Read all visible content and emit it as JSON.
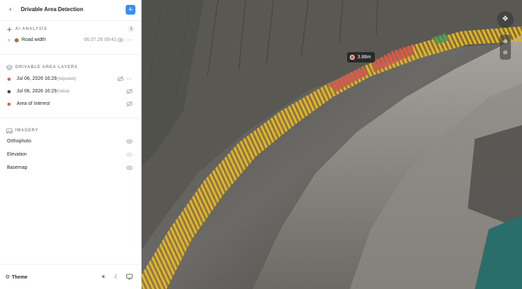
{
  "header": {
    "back_icon": "chevron-left-icon",
    "title": "Drivable Area Detection",
    "add_icon": "plus-icon"
  },
  "ai_analysis": {
    "title": "AI ANALYSIS",
    "count": "1",
    "item": {
      "label": "Road width",
      "timestamp": "06.07.26 09:41"
    }
  },
  "layers": {
    "title": "DRIVABLE AREA LAYERS",
    "items": [
      {
        "label": "Jul 06, 2026 16:29",
        "tag": "(Adjusted)",
        "dot_color": "#e5534b"
      },
      {
        "label": "Jul 06, 2026 16:29",
        "tag": "(Initial)",
        "dot_color": "#3d3d3d"
      },
      {
        "label": "Area of Interest",
        "tag": "",
        "dot_color": "#e5534b"
      }
    ]
  },
  "imagery": {
    "title": "IMAGERY",
    "items": [
      {
        "label": "Orthophoto"
      },
      {
        "label": "Elevation"
      },
      {
        "label": "Basemap"
      }
    ]
  },
  "footer": {
    "theme_label": "Theme"
  },
  "map": {
    "measurement": "3.88m"
  },
  "colors": {
    "accent": "#3a8ef2",
    "road_yellow": "#e8b520",
    "road_red": "#e5534b",
    "road_green": "#4aa35a"
  }
}
